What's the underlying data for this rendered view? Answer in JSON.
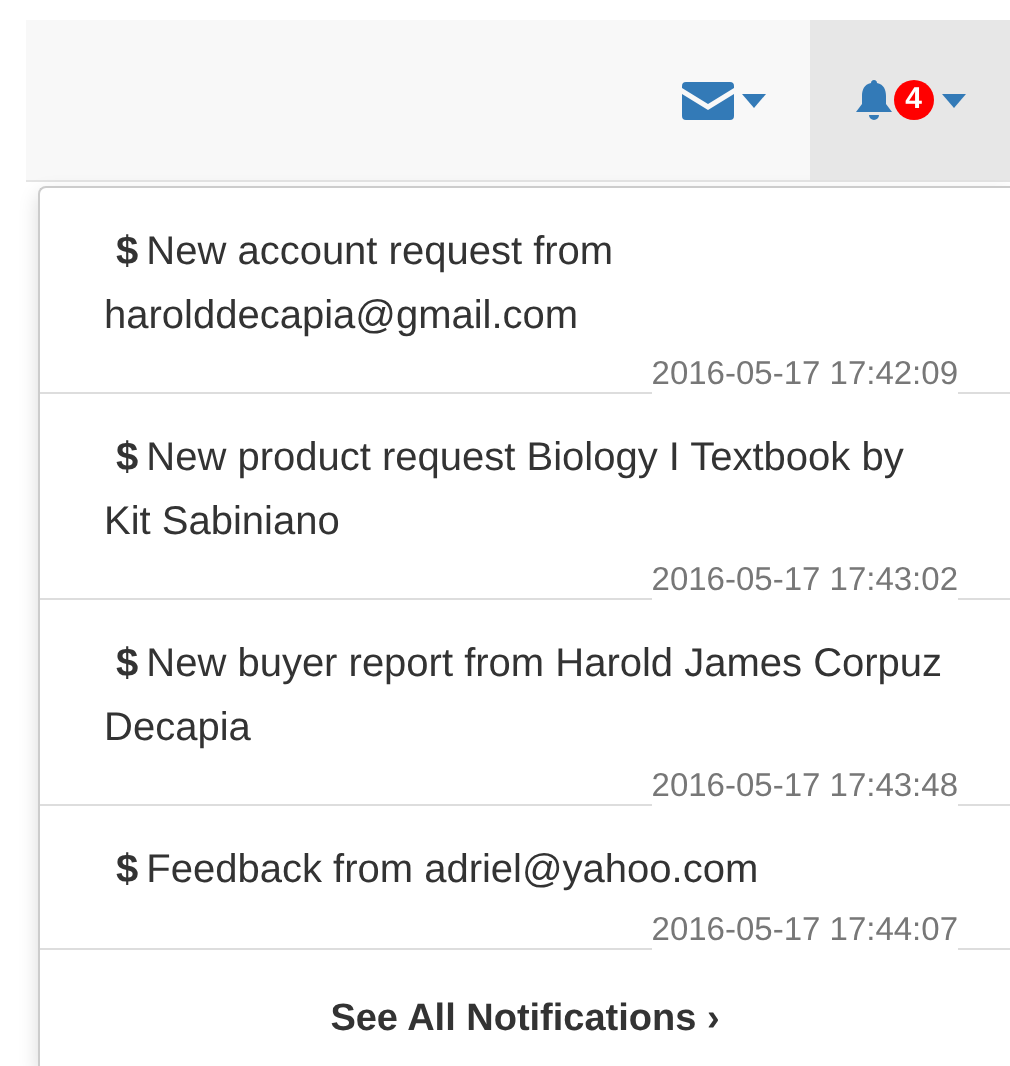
{
  "navbar": {
    "badge": "4"
  },
  "notifications": [
    {
      "symbol": "$",
      "message": "New account request from harolddecapia@gmail.com",
      "time": "2016-05-17 17:42:09"
    },
    {
      "symbol": "$",
      "message": "New product request Biology I Textbook by Kit Sabiniano",
      "time": "2016-05-17 17:43:02"
    },
    {
      "symbol": "$",
      "message": "New buyer report from Harold James Corpuz Decapia",
      "time": "2016-05-17 17:43:48"
    },
    {
      "symbol": "$",
      "message": "Feedback from adriel@yahoo.com",
      "time": "2016-05-17 17:44:07"
    }
  ],
  "footer": {
    "label": "See All Notifications",
    "arrow": "›"
  }
}
